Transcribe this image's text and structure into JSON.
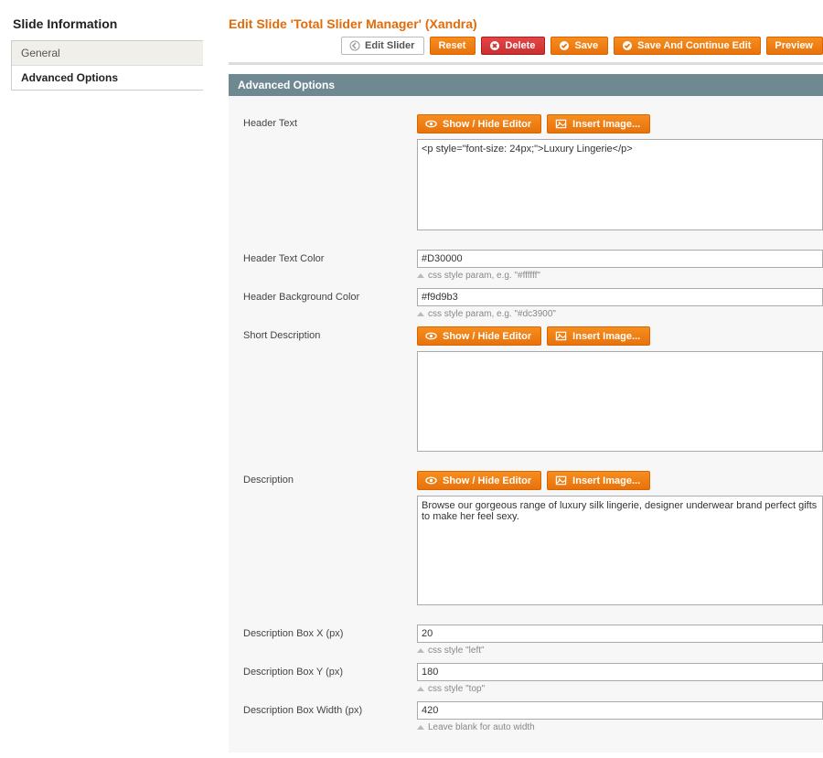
{
  "sidebar": {
    "title": "Slide Information",
    "tabs": [
      {
        "label": "General"
      },
      {
        "label": "Advanced Options"
      }
    ]
  },
  "header": {
    "page_title": "Edit Slide 'Total Slider Manager' (Xandra)",
    "buttons": {
      "edit_slider": "Edit Slider",
      "reset": "Reset",
      "delete": "Delete",
      "save": "Save",
      "save_continue": "Save And Continue Edit",
      "preview": "Preview"
    }
  },
  "section_title": "Advanced Options",
  "editor_buttons": {
    "show_hide": "Show / Hide Editor",
    "insert_image": "Insert Image..."
  },
  "fields": {
    "header_text": {
      "label": "Header Text",
      "value": "<p style=\"font-size: 24px;\">Luxury Lingerie</p>"
    },
    "header_text_color": {
      "label": "Header Text Color",
      "value": "#D30000",
      "hint": "css style param, e.g. \"#ffffff\""
    },
    "header_bg_color": {
      "label": "Header Background Color",
      "value": "#f9d9b3",
      "hint": "css style param, e.g. \"#dc3900\""
    },
    "short_description": {
      "label": "Short Description",
      "value": ""
    },
    "description": {
      "label": "Description",
      "value": "Browse our gorgeous range of luxury silk lingerie, designer underwear brand perfect gifts to make her feel sexy."
    },
    "desc_box_x": {
      "label": "Description Box X (px)",
      "value": "20",
      "hint": "css style \"left\""
    },
    "desc_box_y": {
      "label": "Description Box Y (px)",
      "value": "180",
      "hint": "css style \"top\""
    },
    "desc_box_width": {
      "label": "Description Box Width (px)",
      "value": "420",
      "hint": "Leave blank for auto width"
    }
  }
}
